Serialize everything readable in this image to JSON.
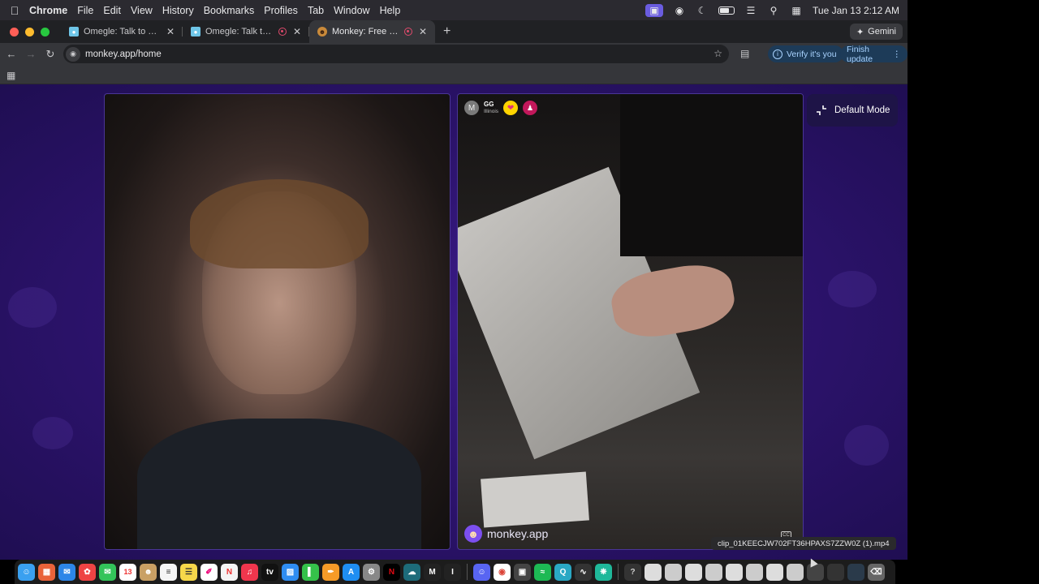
{
  "menubar": {
    "app": "Chrome",
    "items": [
      "File",
      "Edit",
      "View",
      "History",
      "Bookmarks",
      "Profiles",
      "Tab",
      "Window",
      "Help"
    ],
    "clock": "Tue Jan 13  2:12 AM"
  },
  "tabs": [
    {
      "title": "Omegle: Talk to Strangers with",
      "recording": false
    },
    {
      "title": "Omegle: Talk to Strangers",
      "recording": true
    },
    {
      "title": "Monkey: Free Live Video Chat",
      "recording": true,
      "active": true
    }
  ],
  "gemini_label": "Gemini",
  "address": {
    "url": "monkey.app/home"
  },
  "toolbar": {
    "verify_label": "Verify it's you",
    "finish_label": "Finish update"
  },
  "peer": {
    "initial": "M",
    "name": "GG",
    "location": "Illinois"
  },
  "watermark": {
    "text": "monkey.app"
  },
  "mode_button": {
    "label": "Default Mode"
  },
  "dock": {
    "calendar_day": "13",
    "tooltip": "clip_01KEECJW702FT36HPAXS7ZZW0Z (1).mp4"
  },
  "colors": {
    "page_bg": "#2a1268",
    "accent": "#7c4ff0",
    "chip": "#1d3b58"
  }
}
